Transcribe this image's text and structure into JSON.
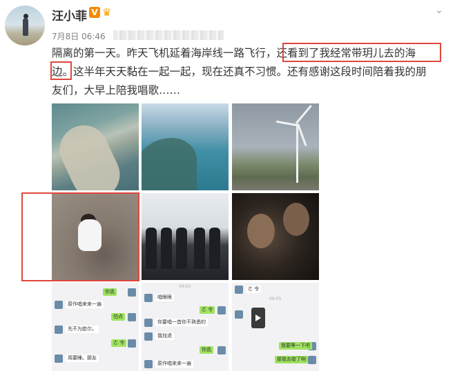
{
  "user": {
    "name": "汪小菲",
    "verified_badge": "V",
    "crown": "♛"
  },
  "post": {
    "date": "7月8日 06:46",
    "text_line1": "隔离的第一天。昨天飞机延着海岸线一路飞行，还看到了我经常带玥儿去的海",
    "text_line2": "边。这半年天天黏在一起一起，现在还真不习惯。还有感谢这段时间陪着我的朋",
    "text_line3": "友们，大早上陪我唱歌……"
  },
  "colors": {
    "highlight": "#e0463b",
    "badge": "#f58a00",
    "wechat_green": "#9fe35f"
  },
  "chat1": {
    "bubbles": [
      "你逃",
      "原作唱来来一遍",
      "怕点",
      "先不为脸尔。",
      "ㄜ 令",
      "用要睡。那友"
    ]
  },
  "chat2": {
    "time": "09:02",
    "bubbles": [
      "唱眼眼",
      "ㄜ 令",
      "你要唱一首你不熟悉的",
      "我找退",
      "你逃",
      "原作唱来来一遍"
    ]
  },
  "chat3": {
    "time": "09:05",
    "bubbles": [
      "ㄜ 令",
      "我要等一下吧",
      "那我去歇了啊"
    ]
  },
  "icons": {
    "more": "chevron-down-icon"
  }
}
